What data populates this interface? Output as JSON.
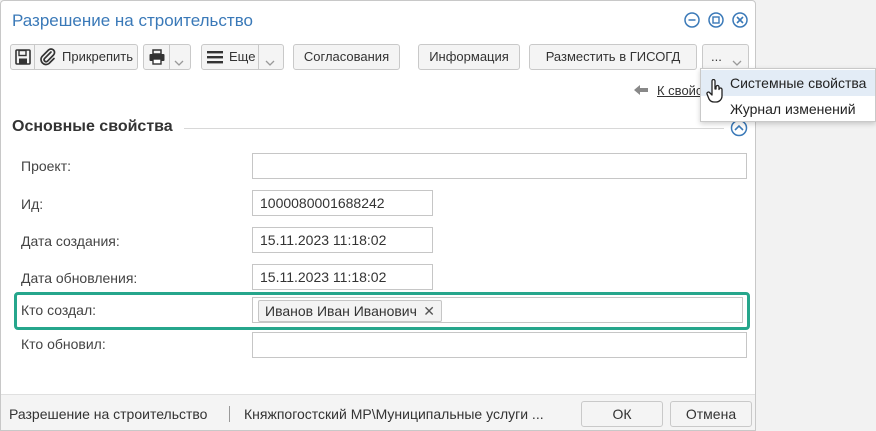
{
  "window": {
    "title": "Разрешение на строительство"
  },
  "toolbar": {
    "attach_label": "Прикрепить",
    "more_label": "Еще",
    "approvals_label": "Согласования",
    "info_label": "Информация",
    "publish_label": "Разместить в ГИСОГД",
    "overflow_label": "..."
  },
  "link_back": "К свойс",
  "section": {
    "title": "Основные свойства"
  },
  "fields": {
    "project": {
      "label": "Проект:",
      "value": ""
    },
    "id": {
      "label": "Ид:",
      "value": "1000080001688242"
    },
    "created": {
      "label": "Дата создания:",
      "value": "15.11.2023 11:18:02"
    },
    "updated": {
      "label": "Дата обновления:",
      "value": "15.11.2023 11:18:02"
    },
    "created_by": {
      "label": "Кто создал:",
      "value": "Иванов Иван Иванович"
    },
    "updated_by": {
      "label": "Кто обновил:",
      "value": ""
    }
  },
  "footer": {
    "doc_type": "Разрешение на строительство",
    "path": "Княжпогостский МР\\Муниципальные услуги ...",
    "ok_label": "ОК",
    "cancel_label": "Отмена"
  },
  "menu": {
    "items": [
      "Системные свойства",
      "Журнал изменений"
    ]
  },
  "colors": {
    "title": "#3a79b8",
    "highlight": "#26a68c",
    "menu_hover": "#e3ecf6"
  },
  "icons": [
    "minimize-icon",
    "restore-icon",
    "close-icon",
    "save-icon",
    "paperclip-icon",
    "printer-icon",
    "menu-icon",
    "chevron-down-icon",
    "back-arrow-icon",
    "collapse-icon",
    "remove-tag-icon",
    "hand-cursor-icon"
  ]
}
